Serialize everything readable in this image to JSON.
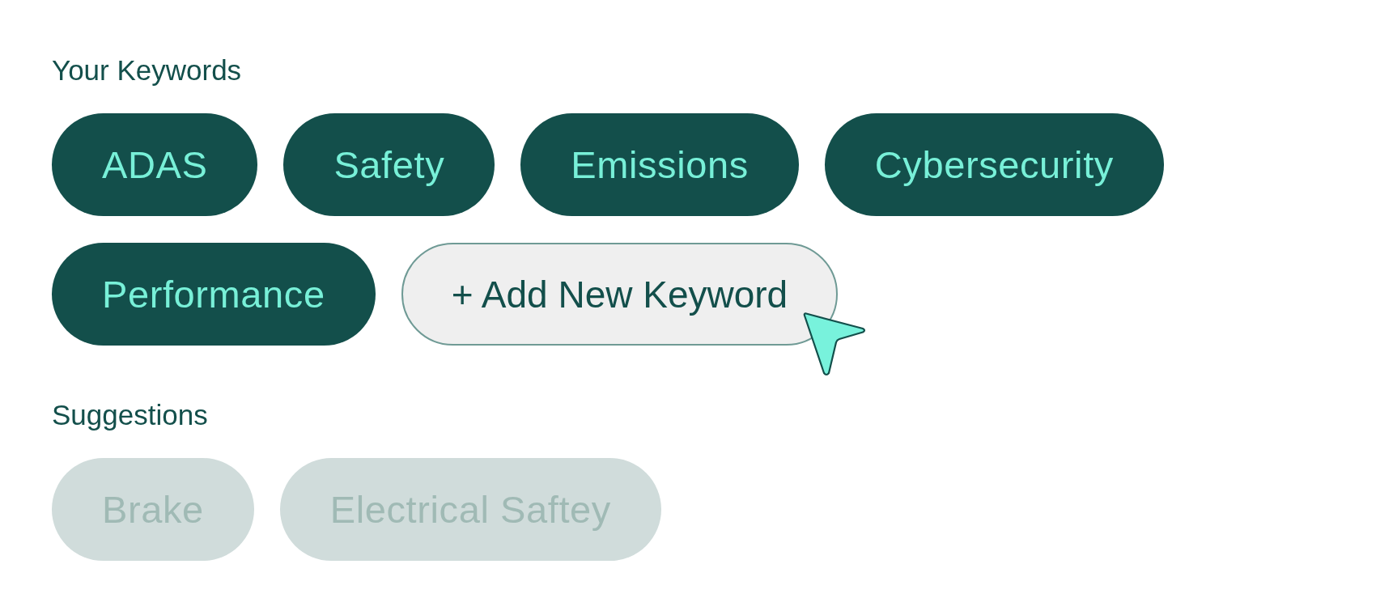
{
  "keywords_section": {
    "label": "Your Keywords",
    "keywords": [
      {
        "label": "ADAS"
      },
      {
        "label": "Safety"
      },
      {
        "label": "Emissions"
      },
      {
        "label": "Cybersecurity"
      },
      {
        "label": "Performance"
      }
    ],
    "add_button": {
      "label": "+ Add New Keyword",
      "hovered": true
    }
  },
  "suggestions_section": {
    "label": "Suggestions",
    "suggestions": [
      {
        "label": "Brake"
      },
      {
        "label": "Electrical Saftey"
      }
    ]
  }
}
